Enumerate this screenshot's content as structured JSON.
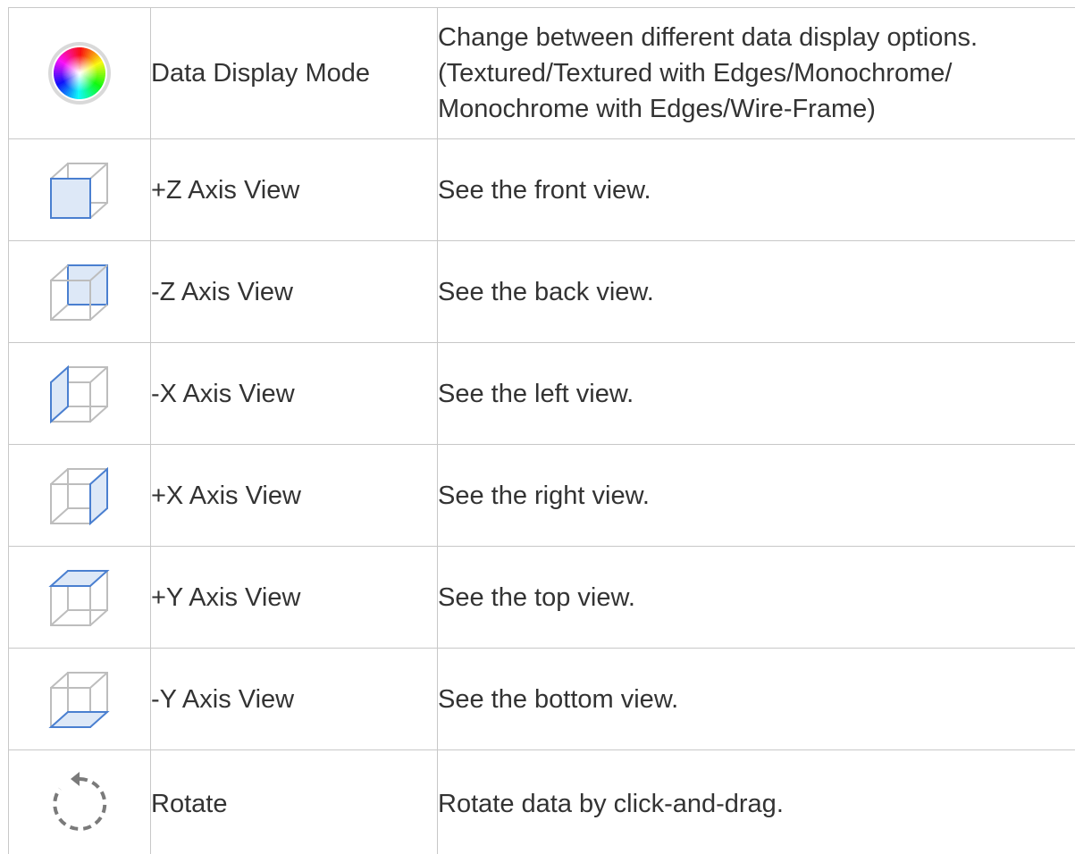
{
  "rows": [
    {
      "icon": "color-wheel-icon",
      "name": "Data Display Mode",
      "desc_lines": [
        "Change between different data display options.",
        "(Textured/Textured with Edges/Monochrome/",
        "Monochrome with Edges/Wire-Frame)"
      ]
    },
    {
      "icon": "plus-z-axis-view-icon",
      "name": "+Z Axis View",
      "desc_lines": [
        "See the front view."
      ]
    },
    {
      "icon": "minus-z-axis-view-icon",
      "name": "-Z Axis View",
      "desc_lines": [
        "See the back view."
      ]
    },
    {
      "icon": "minus-x-axis-view-icon",
      "name": "-X Axis View",
      "desc_lines": [
        "See the left view."
      ]
    },
    {
      "icon": "plus-x-axis-view-icon",
      "name": "+X Axis View",
      "desc_lines": [
        "See the right view."
      ]
    },
    {
      "icon": "plus-y-axis-view-icon",
      "name": "+Y Axis View",
      "desc_lines": [
        "See the top view."
      ]
    },
    {
      "icon": "minus-y-axis-view-icon",
      "name": "-Y Axis View",
      "desc_lines": [
        "See the bottom view."
      ]
    },
    {
      "icon": "rotate-icon",
      "name": "Rotate",
      "desc_lines": [
        "Rotate data by click-and-drag."
      ]
    }
  ],
  "colors": {
    "text": "#333333",
    "border": "#c8c8c8",
    "cube_highlight": "#4a7fd0",
    "cube_fill": "#dde8f7",
    "cube_gray": "#bdbdbd"
  }
}
